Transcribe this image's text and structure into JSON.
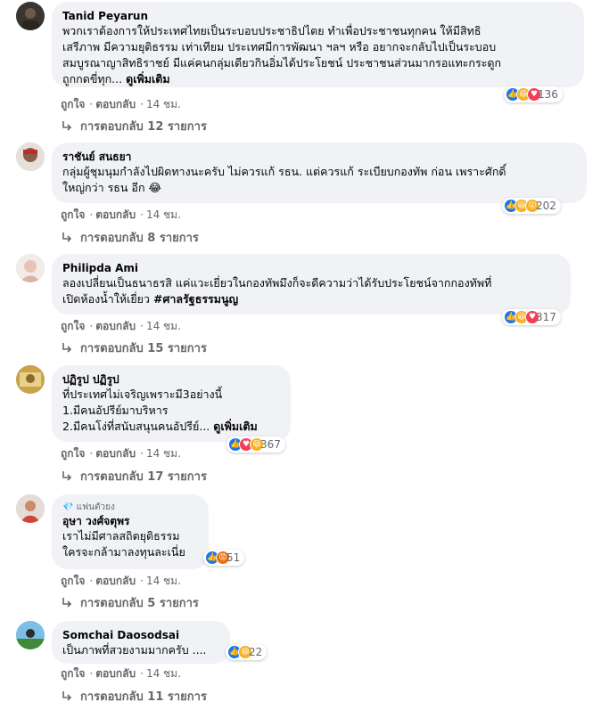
{
  "labels": {
    "like": "ถูกใจ",
    "reply": "ตอบกลับ",
    "dot": "·"
  },
  "comments": [
    {
      "name": "Tanid Peyarun",
      "text": "พวกเราต้องการให้ประเทศไทยเป็นระบอบประชาธิปไตย ทำเพื่อประชาชนทุกคน ให้มีสิทธิ\nเสรีภาพ มีความยุติธรรม เท่าเทียม ประเทศมีการพัฒนา ฯลฯ หรือ อยากจะกลับไปเป็นระบอบ\nสมบูรณาญาสิทธิราชย์ มีแค่คนกลุ่มเดียวกินอิ่มได้ประโยชน์ ประชาชนส่วนมากรอแทะกระดูก\nถูกกดขี่ทุก... ",
      "see_more": "ดูเพิ่มเติม",
      "reactions": [
        "like",
        "haha",
        "love"
      ],
      "reaction_count": "136",
      "time": "14 ชม.",
      "replies": "การตอบกลับ 12 รายการ"
    },
    {
      "name": "ราชันย์ สนธยา",
      "text": "กลุ่มผู้ชุมนุมกำลังไปผิดทางนะครับ ไม่ควรแก้ รธน. แต่ควรแก้ ระเบียบกองทัพ ก่อน เพราะศักดิ์\nใหญ่กว่า รธน อีก 😂",
      "reactions": [
        "like",
        "haha",
        "wow"
      ],
      "reaction_count": "202",
      "time": "14 ชม.",
      "replies": "การตอบกลับ 8 รายการ"
    },
    {
      "name": "Philipda Ami",
      "text": "ลองเปลี่ยนเป็นธนาธรสิ แค่แวะเยี่ยวในกองทัพมึงก็จะดีความว่าได้รับประโยชน์จากกองทัพที่\nเปิดห้องน้ำให้เยี่ยว ",
      "hashtag": "#ศาลรัฐธรรมนูญ",
      "reactions": [
        "like",
        "haha",
        "love"
      ],
      "reaction_count": "317",
      "time": "14 ชม.",
      "replies": "การตอบกลับ 15 รายการ"
    },
    {
      "name": "ปฏิรูป ปฏิรูป",
      "text": "ที่ประเทศไม่เจริญเพราะมี3อย่างนี้\n1.มีคนอัปรีย์มาบริหาร\n2.มีคนโง่ที่สนับสนุนคนอัปรีย์... ",
      "see_more": "ดูเพิ่มเติม",
      "reactions": [
        "like",
        "love",
        "haha"
      ],
      "reaction_count": "367",
      "time": "14 ชม.",
      "replies": "การตอบกลับ 17 รายการ"
    },
    {
      "badge": "แฟนตัวยง",
      "name": "อุษา วงศ์จตุพร",
      "text": "เราไม่มีศาลสถิตยุติธรรม\nใครจะกล้ามาลงทุนละเนี่ย",
      "reactions": [
        "like",
        "angry"
      ],
      "reaction_count": "51",
      "time": "14 ชม.",
      "replies": "การตอบกลับ 5 รายการ"
    },
    {
      "name": "Somchai Daosodsai",
      "text": "เป็นภาพที่สวยงามมากครับ ....",
      "reactions": [
        "like",
        "haha"
      ],
      "reaction_count": "22",
      "time": "14 ชม.",
      "replies": "การตอบกลับ 11 รายการ"
    }
  ]
}
